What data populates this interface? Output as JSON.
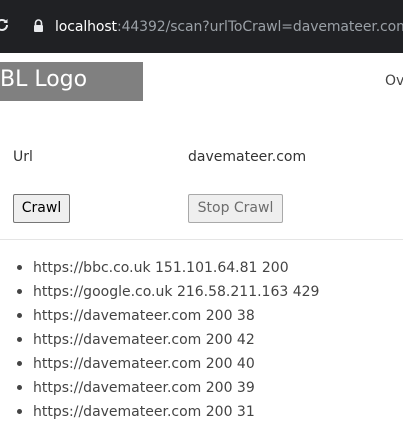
{
  "browser": {
    "url_host": "localhost",
    "url_rest": ":44392/scan?urlToCrawl=davemateer.com"
  },
  "header": {
    "logo_text": "BL Logo",
    "nav_link": "Ov"
  },
  "form": {
    "url_label": "Url",
    "url_value": "davemateer.com",
    "crawl_label": "Crawl",
    "stop_label": "Stop Crawl"
  },
  "results": [
    "https://bbc.co.uk 151.101.64.81 200",
    "https://google.co.uk 216.58.211.163 429",
    "https://davemateer.com 200 38",
    "https://davemateer.com 200 42",
    "https://davemateer.com 200 40",
    "https://davemateer.com 200 39",
    "https://davemateer.com 200 31"
  ]
}
